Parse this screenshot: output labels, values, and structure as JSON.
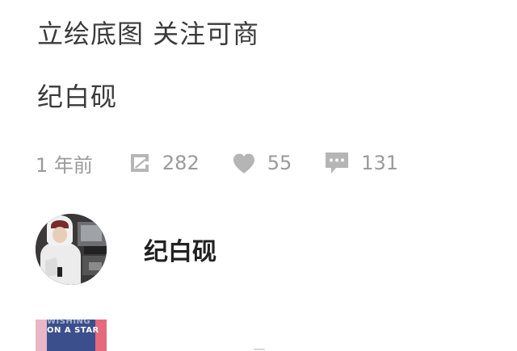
{
  "post": {
    "title": "立绘底图  关注可商",
    "body": "纪白砚"
  },
  "meta": {
    "time": "1 年前",
    "reblogs": "282",
    "likes": "55",
    "comments": "131",
    "icons": {
      "reblog": "reblog-icon",
      "like": "heart-icon",
      "comment": "comment-icon"
    },
    "icon_color": "#b5b5b5"
  },
  "author": {
    "name": "纪白砚"
  },
  "thumbnail": {
    "line1": "WISHING",
    "line2": "ON A STAR"
  }
}
